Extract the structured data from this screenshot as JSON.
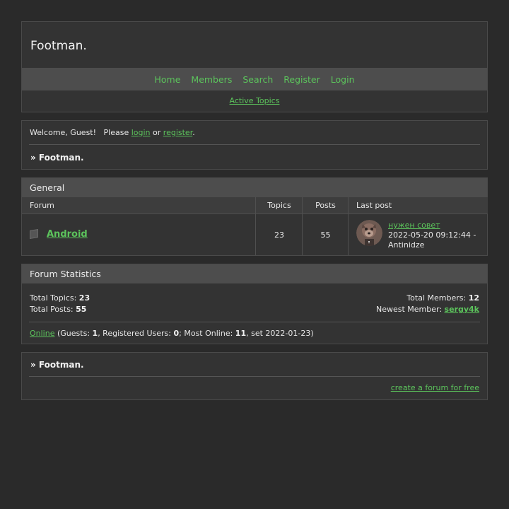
{
  "site": {
    "title": "Footman."
  },
  "nav": {
    "home": "Home",
    "members": "Members",
    "search": "Search",
    "register": "Register",
    "login": "Login"
  },
  "subnav": {
    "active_topics": "Active Topics"
  },
  "welcome": {
    "greeting": "Welcome, Guest!",
    "please": "Please",
    "login_link": "login",
    "or": "or",
    "register_link": "register",
    "period": "."
  },
  "breadcrumb": {
    "text": "» Footman."
  },
  "category": {
    "name": "General",
    "columns": {
      "forum": "Forum",
      "topics": "Topics",
      "posts": "Posts",
      "last_post": "Last post"
    },
    "forums": [
      {
        "name": "Android",
        "topics": "23",
        "posts": "55",
        "last_post_title": "нужен совет",
        "last_post_date": "2022-05-20 09:12:44 -",
        "last_post_author": "Antinidze"
      }
    ]
  },
  "stats": {
    "title": "Forum Statistics",
    "total_topics_label": "Total Topics:",
    "total_topics": "23",
    "total_posts_label": "Total Posts:",
    "total_posts": "55",
    "total_members_label": "Total Members:",
    "total_members": "12",
    "newest_member_label": "Newest Member:",
    "newest_member": "sergy4k",
    "online_link": "Online",
    "guests_label": "(Guests:",
    "guests": "1",
    "registered_label": ", Registered Users:",
    "registered": "0",
    "most_online_label": "; Most Online:",
    "most_online": "11",
    "most_online_date": ", set 2022-01-23)"
  },
  "footer": {
    "breadcrumb": "» Footman.",
    "create_forum": "create a forum for free"
  },
  "colors": {
    "background": "#2a2a2a",
    "panel": "#333333",
    "bar": "#4d4d4d",
    "link": "#5cc45c"
  }
}
